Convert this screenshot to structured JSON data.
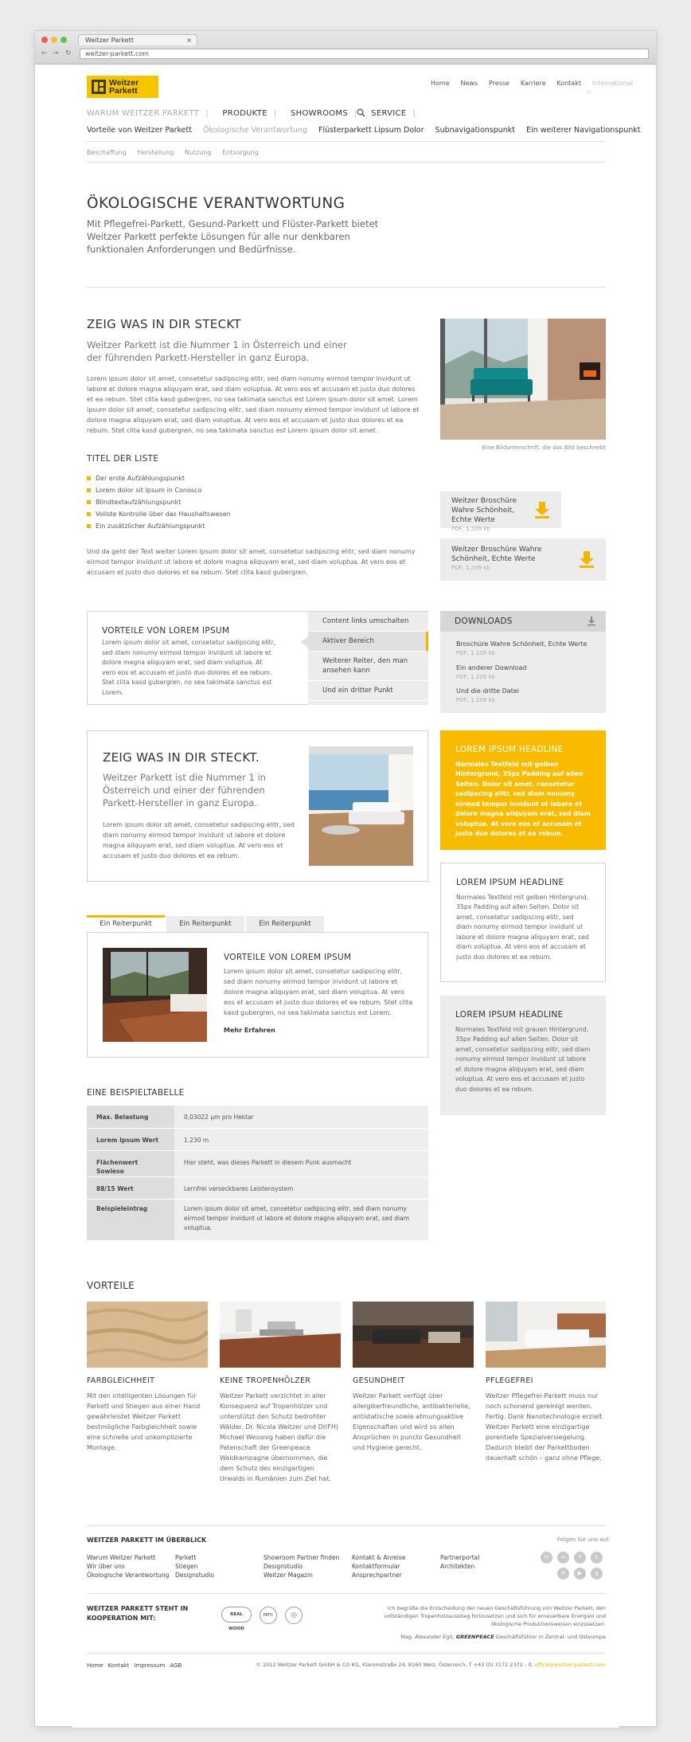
{
  "browser": {
    "tab_title": "Weitzer Parkett",
    "tab_close": "×",
    "url": "weitzer-parkett.com",
    "back": "←",
    "forward": "→",
    "reload": "↻"
  },
  "header": {
    "logo_line1": "Weitzer",
    "logo_line2": "Parkett",
    "meta_links": [
      "Home",
      "News",
      "Presse",
      "Karriere",
      "Kontakt"
    ],
    "meta_international": "International",
    "main_nav": [
      "WARUM WEITZER PARKETT",
      "PRODUKTE",
      "SHOWROOMS",
      "SERVICE"
    ],
    "sub_nav": [
      "Vorteile von Weitzer Parkett",
      "Ökologische Verantwortung",
      "Flüsterparkett Lipsum Dolor",
      "Subnavigationspunkt",
      "Ein weiterer Navigationspunkt"
    ],
    "third_nav": [
      "Beschaffung",
      "Herstellung",
      "Nutzung",
      "Entsorgung"
    ]
  },
  "intro": {
    "title": "ÖKOLOGISCHE VERANTWORTUNG",
    "text": "Mit Pflegefrei-Parkett, Gesund-Parkett und Flüster-Parkett bietet Weitzer Parkett perfekte Lösungen für alle nur denkbaren funktionalen Anforderungen und Bedürfnisse."
  },
  "section1": {
    "title": "ZEIG WAS IN DIR STECKT",
    "lead": "Weitzer Parkett ist die Nummer 1 in Österreich und einer der führenden Parkett-Hersteller in ganz Europa.",
    "body": "Lorem ipsum dolor sit amet, consetetur sadipscing elitr, sed diam nonumy eirmod tempor invidunt ut labore et dolore magna aliquyam erat, sed diam voluptua. At vero eos et accusam et justo duo dolores et ea rebum. Stet clita kasd gubergren, no sea takimata sanctus est Lorem ipsum dolor sit amet. Lorem ipsum dolor sit amet, consetetur sadipscing elitr, sed diam nonumy eirmod tempor invidunt ut labore et dolore magna aliquyam erat, sed diam voluptua. At vero eos et accusam et justo duo dolores et ea rebum. Stet clita kasd gubergren, no sea takimata sanctus est Lorem ipsum dolor sit amet.",
    "caption": "Eine Bildunterschrift, die das Bild beschreibt",
    "list_title": "TITEL DER LISTE",
    "list": [
      "Der erste Aufzählungspunkt",
      "Lorem dolor sit Ipsum in Conosco",
      "Blindtextaufzählungspunkt",
      "Vollste Kontrolle über das Haushaltswesen",
      "Ein zusätzlicher Aufzählungspunkt"
    ],
    "closing": "Und da geht der Text weiter Lorem ipsum dolor sit amet, consetetur sadipscing elitr, sed diam nonumy eirmod tempor invidunt ut labore et dolore magna aliquyam erat, sed diam voluptua. At vero eos et accusam et justo duo dolores et ea rebum. Stet clita kasd gubergren.",
    "download_small": {
      "title": "Weitzer Broschüre Wahre Schönheit, Echte Werte",
      "meta": "PDF, 1.209 kb"
    },
    "download_large": {
      "title": "Weitzer Broschüre Wahre Schönheit, Echte Werte",
      "meta": "PDF, 1.209 kb"
    }
  },
  "vorteile_box": {
    "title": "VORTEILE VON LOREM IPSUM",
    "text": "Lorem ipsum dolor sit amet, consetetur sadipscing elitr, sed diam nonumy eirmod tempor invidunt ut labore et dolore magna aliquyam erat, sed diam voluptua. At vero eos et accusam et justo duo dolores et ea rebum. Stet clita kasd gubergren, no sea takimata sanctus est Lorem.",
    "menu": [
      "Content links umschalten",
      "Aktiver Bereich",
      "Weiterer Reiter, den man ansehen kann",
      "Und ein dritter Punkt"
    ]
  },
  "downloads": {
    "title": "DOWNLOADS",
    "items": [
      {
        "title": "Broschüre Wahre Schönheit, Echte Werte",
        "meta": "PDF, 1.209 kb"
      },
      {
        "title": "Ein anderer Download",
        "meta": "PDF, 1.209 kb"
      },
      {
        "title": "Und die dritte Datei",
        "meta": "PDF, 1.209 kb"
      }
    ]
  },
  "teaser": {
    "title": "ZEIG WAS IN DIR STECKT.",
    "lead": "Weitzer Parkett ist die Nummer 1 in Österreich und einer der führenden Parkett-Hersteller in ganz Europa.",
    "body": "Lorem ipsum dolor sit amet, consetetur sadipscing elitr, sed diam nonumy eirmod tempor invidunt ut labore et dolore magna aliquyam erat, sed diam voluptua. At vero eos et accusam et justo duo dolores et ea rebum."
  },
  "sideboxes": [
    {
      "title": "LOREM IPSUM HEADLINE",
      "text": "Normales Textfeld mit gelben Hintergrund, 35px Padding auf allen Seiten. Dolor sit amet, consetetur sadipscing elitr, sed diam nonumy eirmod tempor invidunt ut labore et dolore magna aliquyam erat, sed diam voluptua. At vero eos et accusam et justo duo dolores et ea rebum."
    },
    {
      "title": "LOREM IPSUM HEADLINE",
      "text": "Normales Textfeld mit gelben Hintergrund, 35px Padding auf allen Seiten. Dolor sit amet, consetetur sadipscing elitr, sed diam nonumy eirmod tempor invidunt ut labore et dolore magna aliquyam erat, sed diam voluptua. At vero eos et accusam et justo duo dolores et ea rebum."
    },
    {
      "title": "LOREM IPSUM HEADLINE",
      "text": "Normales Textfeld mit grauen Hintergrund, 35px Padding auf allen Seiten. Dolor sit amet, consetetur sadipscing elitr, sed diam nonumy eirmod tempor invidunt ut labore et dolore magna aliquyam erat, sed diam voluptua. At vero eos et accusam et justo duo dolores et ea rebum."
    }
  ],
  "tabs": {
    "labels": [
      "Ein Reiterpunkt",
      "Ein Reiterpunkt",
      "Ein Reiterpunkt"
    ],
    "title": "VORTEILE VON LOREM IPSUM",
    "text": "Lorem ipsum dolor sit amet, consetetur sadipscing elitr, sed diam nonumy eirmod tempor invidunt ut labore et dolore magna aliquyam erat, sed diam voluptua. At vero eos et accusam et justo duo dolores et ea rebum. Stet clita kasd gubergren, no sea takimata sanctus est Lorem.",
    "more": "Mehr Erfahren"
  },
  "table": {
    "title": "EINE BEISPIELTABELLE",
    "rows": [
      [
        "Max. Belastung",
        "0,03022 μm pro Hektar"
      ],
      [
        "Lorem Ipsum Wert",
        "1.230 m"
      ],
      [
        "Flächenwert Sowieso",
        "Hier steht, was dieses Parkett in diesem Punk ausmacht"
      ],
      [
        "88/15 Wert",
        "Lernfrei verseckbares Leistensystem"
      ],
      [
        "Beispieleintrag",
        "Lorem ipsum dolor sit amet, consetetur sadipscing elitr, sed diam nonumy eirmod tempor invidunt ut labore et dolore magna aliquyam erat, sed diam voluptua."
      ]
    ]
  },
  "vorteile": {
    "title": "VORTEILE",
    "cards": [
      {
        "title": "FARBGLEICHHEIT",
        "text": "Mit den intelligenten Lösungen für Parkett und Stiegen aus einer Hand gewährleistet Weitzer Parkett bestmögliche Farbgleichheit sowie eine schnelle und unkomplizierte Montage."
      },
      {
        "title": "KEINE TROPENHÖLZER",
        "text": "Weitzer Parkett verzichtet in aller Konsequenz auf Tropenhölzer und unterstützt den Schutz bedrohter Wälder. Dr. Nicola Weitzer und DI(FH) Michael Wesonig haben dafür die Patenschaft der Greenpeace Waldkampagne übernommen, die dem Schutz des einzigartigen Urwalds in Rumänien zum Ziel hat."
      },
      {
        "title": "GESUNDHEIT",
        "text": "Weitzer Parkett verfügt über allergikerfreundliche, antibakterielle, antistatische sowie atmungsaktive Eigenschaften und wird so allen Ansprüchen in puncto Gesundheit und Hygiene gerecht."
      },
      {
        "title": "PFLEGEFREI",
        "text": "Weitzer Pflegefrei-Parkett muss nur noch schonend gereinigt werden. Fertig. Dank Nanotechnologie erzielt Weitzer Parkett eine einzigartige porentiefe Spezialversiegelung. Dadurch bleibt der Parkettboden dauerhaft schön – ganz ohne Pflege."
      }
    ]
  },
  "footer": {
    "overview_title": "WEITZER PARKETT IM ÜBERBLICK",
    "follow": "Folgen Sie uns auf:",
    "cols": [
      [
        "Warum Weitzer Parkett",
        "Wir über uns",
        "Ökologische Verantwortung"
      ],
      [
        "Parkett",
        "Stiegen",
        "Designstudio"
      ],
      [
        "Showroom Partner finden",
        "Designstudio",
        "Weitzer Magazin"
      ],
      [
        "Kontakt & Anreise",
        "Kontaktformular",
        "Ansprechpartner"
      ],
      [
        "Partnerportal",
        "Architekten"
      ]
    ],
    "social": [
      "in",
      "∞",
      "f",
      "t",
      "✕",
      "▶",
      "g"
    ],
    "coop_title": "WEITZER PARKETT STEHT IN KOOPERATION MIT:",
    "coop_logos": [
      "REAL WOOD",
      "PEFC",
      "◎"
    ],
    "quote": "Ich begrüße die Entscheidung der neuen Geschäftsführung von Weitzer Parkett, den vollständigen Tropenholzausstieg fortzusetzen und sich für erneuerbare Energien und ökologische Produktionsweisen einzusetzen.",
    "quote_by": "Mag. Alexander Egit,",
    "quote_brand": "GREENPEACE",
    "quote_role": "Geschäftsführer in Zentral- und Osteuropa",
    "bottom_links": [
      "Home",
      "Kontakt",
      "Impressum",
      "AGB"
    ],
    "copyright": "© 2012 Weitzer Parkett GmbH & CO KG, Klammstraße 24, 8160 Weiz, Österreich, T +43 (0) 3172 2372 - 0,",
    "email": "office@weitzer-parkett.com"
  },
  "colors": {
    "accent": "#f5b400",
    "yellow_box": "#f9bb00",
    "grey_box": "#ececec"
  }
}
